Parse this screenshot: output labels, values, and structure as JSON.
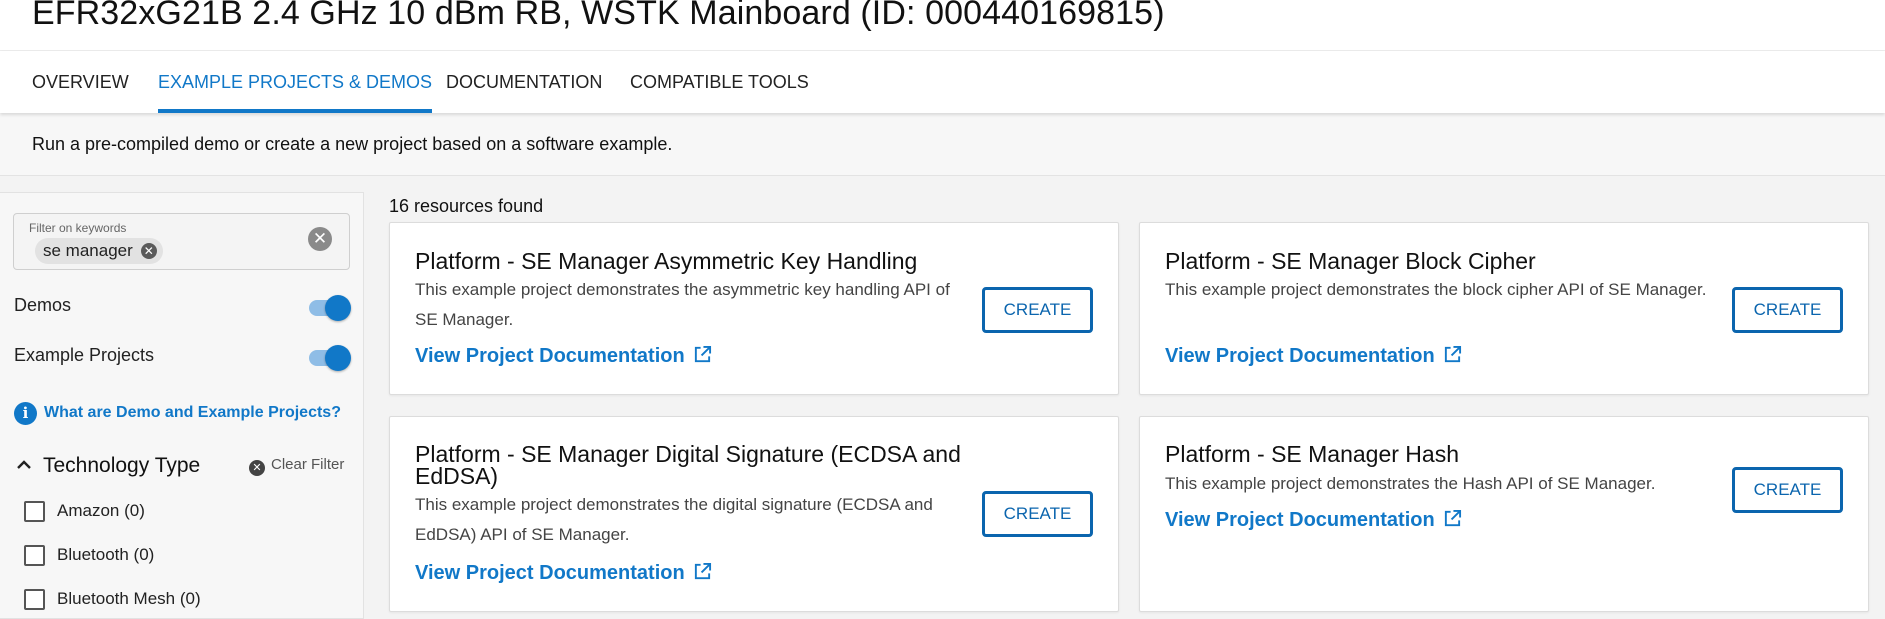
{
  "header": {
    "title": "EFR32xG21B 2.4 GHz 10 dBm RB, WSTK Mainboard (ID: 000440169815)"
  },
  "tabs": [
    {
      "label": "OVERVIEW"
    },
    {
      "label": "EXAMPLE PROJECTS & DEMOS",
      "active": true
    },
    {
      "label": "DOCUMENTATION"
    },
    {
      "label": "COMPATIBLE TOOLS"
    }
  ],
  "banner": {
    "text": "Run a pre-compiled demo or create a new project based on a software example."
  },
  "sidebar": {
    "filter": {
      "label": "Filter on keywords",
      "chip": "se manager"
    },
    "toggles": [
      {
        "label": "Demos",
        "on": true
      },
      {
        "label": "Example Projects",
        "on": true
      }
    ],
    "help_link": "What are Demo and Example Projects?",
    "tech_section": {
      "title": "Technology Type",
      "clear_label": "Clear Filter",
      "items": [
        {
          "label": "Amazon (0)",
          "checked": false
        },
        {
          "label": "Bluetooth (0)",
          "checked": false
        },
        {
          "label": "Bluetooth Mesh (0)",
          "checked": false
        }
      ]
    }
  },
  "results": {
    "count_text": "16 resources found",
    "cards": [
      {
        "title": "Platform - SE Manager Asymmetric Key Handling",
        "description": "This example project demonstrates the asymmetric key handling API of SE Manager.",
        "link": "View Project Documentation",
        "button": "CREATE"
      },
      {
        "title": "Platform - SE Manager Block Cipher",
        "description": "This example project demonstrates the block cipher API of SE Manager.",
        "link": "View Project Documentation",
        "button": "CREATE"
      },
      {
        "title": "Platform - SE Manager Digital Signature (ECDSA and EdDSA)",
        "description": "This example project demonstrates the digital signature (ECDSA and EdDSA) API of SE Manager.",
        "link": "View Project Documentation",
        "button": "CREATE"
      },
      {
        "title": "Platform - SE Manager Hash",
        "description": "This example project demonstrates the Hash API of SE Manager.",
        "link": "View Project Documentation",
        "button": "CREATE"
      }
    ]
  },
  "icons": {
    "close": "close-circle-icon",
    "info": "info-icon",
    "chevron": "chevron-up-icon",
    "external": "external-link-icon",
    "checkbox": "checkbox-icon"
  },
  "colors": {
    "accent": "#1178c8",
    "button_border": "#0b65ae"
  }
}
